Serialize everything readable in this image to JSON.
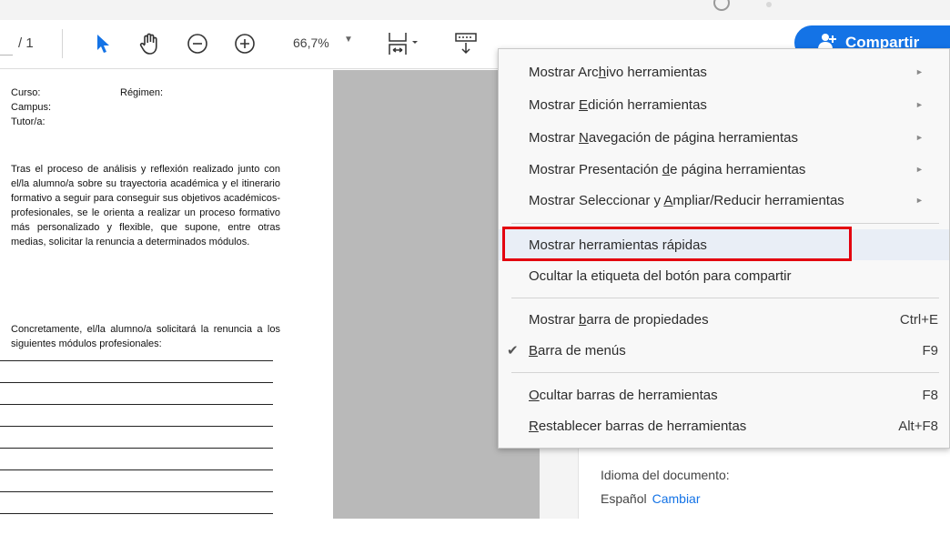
{
  "toolbar": {
    "page_count": "/ 1",
    "zoom": "66,7%",
    "share_label": "Compartir",
    "icons": [
      "select-arrow-icon",
      "hand-icon",
      "zoom-out-icon",
      "zoom-in-icon",
      "fit-page-icon",
      "scroll-mode-icon"
    ]
  },
  "document": {
    "field_curso": "Curso:",
    "field_regimen": "Régimen:",
    "field_campus": "Campus:",
    "field_tutor": "Tutor/a:",
    "paragraph": "Tras el proceso de análisis y reflexión realizado junto con el/la alumno/a sobre su trayectoria académica y el itinerario formativo a seguir para conseguir sus objetivos académicos-profesionales, se le orienta a realizar un proceso formativo más personalizado y flexible, que supone, entre otras medias, solicitar la renuncia a determinados módulos.",
    "paragraph2": "Concretamente, el/la alumno/a solicitará la renuncia a los siguientes módulos profesionales:"
  },
  "panel": {
    "lang_label": "Idioma del documento:",
    "lang_value": "Español",
    "lang_change": "Cambiar"
  },
  "menu": {
    "items": [
      {
        "pre": "Mostrar Arc",
        "u": "h",
        "post": "ivo herramientas",
        "submenu": true
      },
      {
        "pre": "Mostrar ",
        "u": "E",
        "post": "dición herramientas",
        "submenu": true
      },
      {
        "pre": "Mostrar ",
        "u": "N",
        "post": "avegación de página herramientas",
        "submenu": true
      },
      {
        "pre": "Mostrar Presentación ",
        "u": "d",
        "post": "e página herramientas",
        "submenu": true
      },
      {
        "pre": "Mostrar Seleccionar y ",
        "u": "A",
        "post": "mpliar/Reducir herramientas",
        "submenu": true
      },
      {
        "pre": "Mostrar herramientas rápidas",
        "u": "",
        "post": ""
      },
      {
        "pre": "Ocultar la etiqueta del botón para compartir",
        "u": "",
        "post": ""
      },
      {
        "pre": "Mostrar ",
        "u": "b",
        "post": "arra de propiedades",
        "shortcut": "Ctrl+E"
      },
      {
        "pre": "",
        "u": "B",
        "post": "arra de menús",
        "shortcut": "F9",
        "checked": true
      },
      {
        "pre": "",
        "u": "O",
        "post": "cultar barras de herramientas",
        "shortcut": "F8"
      },
      {
        "pre": "",
        "u": "R",
        "post": "establecer barras de herramientas",
        "shortcut": "Alt+F8"
      }
    ],
    "highlighted_item": "Mostrar herramientas rápidas",
    "check_mark": "✔",
    "submenu_arrow": "►"
  },
  "colors": {
    "accent": "#1473e6",
    "highlight_box": "#e3000f",
    "menu_bg": "#f8f8f8"
  }
}
